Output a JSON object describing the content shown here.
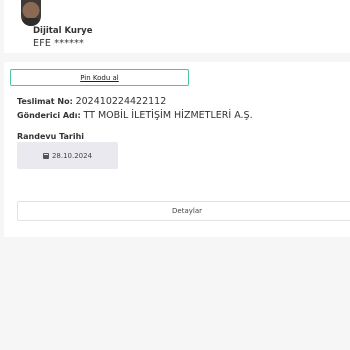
{
  "courier": {
    "role": "Dijital Kurye",
    "name": "EFE ******"
  },
  "pin_button": {
    "label": "Pin Kodu al"
  },
  "delivery": {
    "label": "Teslimat No",
    "value": "202410224422112"
  },
  "sender": {
    "label": "Gönderici Adı",
    "value": "TT MOBİL İLETİŞİM HİZMETLERİ A.Ş."
  },
  "appointment": {
    "label": "Randevu Tarihi",
    "date": "28.10.2024",
    "icon": "calendar-icon"
  },
  "details_button": {
    "label": "Detaylar"
  },
  "colors": {
    "accent": "#4cc3a1",
    "date_box": "#e9e9ef",
    "background": "#f6f6f6"
  }
}
